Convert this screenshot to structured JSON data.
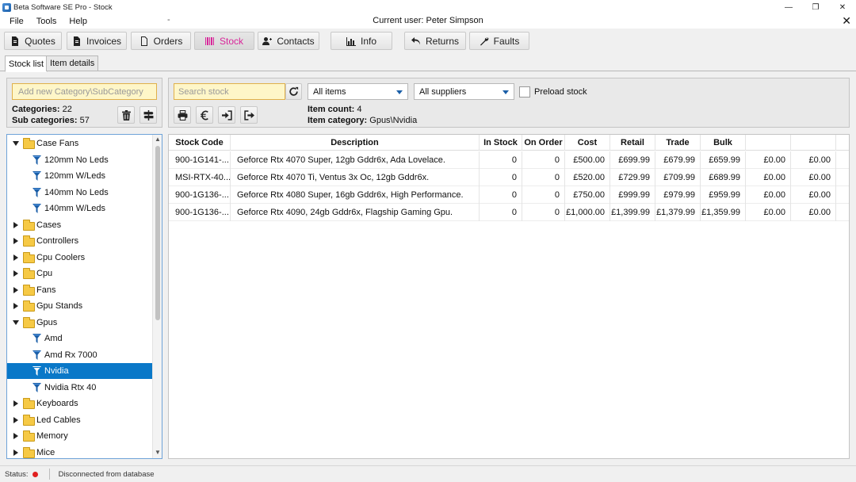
{
  "window": {
    "title": "Beta Software SE Pro - Stock",
    "controls": [
      "—",
      "❐",
      "✕"
    ]
  },
  "menu": {
    "items": [
      "File",
      "Tools",
      "Help"
    ],
    "dash": "-",
    "current_user": "Current user: Peter Simpson",
    "close": "✕"
  },
  "toolbar": {
    "buttons": [
      {
        "label": "Quotes",
        "icon": "document-icon"
      },
      {
        "label": "Invoices",
        "icon": "document-icon"
      },
      {
        "label": "Orders",
        "icon": "blank-document-icon"
      },
      {
        "label": "Stock",
        "icon": "barcode-icon",
        "active": true
      },
      {
        "label": "Contacts",
        "icon": "add-user-icon"
      },
      {
        "label": "Info",
        "icon": "bar-chart-icon"
      },
      {
        "label": "Returns",
        "icon": "undo-icon"
      },
      {
        "label": "Faults",
        "icon": "wrench-icon"
      }
    ],
    "active_color": "#d8279a"
  },
  "tabs": [
    "Stock list",
    "Item details"
  ],
  "category_panel": {
    "placeholder": "Add new Category\\SubCategory",
    "categories_label": "Categories:",
    "categories_count": "22",
    "subcategories_label": "Sub categories:",
    "subcategories_count": "57"
  },
  "stock_panel": {
    "search_placeholder": "Search stock",
    "items_filter": "All items",
    "suppliers_filter": "All suppliers",
    "preload_label": "Preload stock",
    "item_count_label": "Item count:",
    "item_count": "4",
    "item_category_label": "Item category:",
    "item_category": "Gpus\\Nvidia"
  },
  "tree": {
    "selected_color": "#0a78c8",
    "rows": [
      {
        "label": "Case Fans",
        "type": "folder",
        "expanded": true
      },
      {
        "label": "120mm No Leds",
        "type": "leaf"
      },
      {
        "label": "120mm W/Leds",
        "type": "leaf"
      },
      {
        "label": "140mm No Leds",
        "type": "leaf"
      },
      {
        "label": "140mm W/Leds",
        "type": "leaf"
      },
      {
        "label": "Cases",
        "type": "folder",
        "expanded": false
      },
      {
        "label": "Controllers",
        "type": "folder",
        "expanded": false
      },
      {
        "label": "Cpu Coolers",
        "type": "folder",
        "expanded": false
      },
      {
        "label": "Cpu",
        "type": "folder",
        "expanded": false
      },
      {
        "label": "Fans",
        "type": "folder",
        "expanded": false
      },
      {
        "label": "Gpu Stands",
        "type": "folder",
        "expanded": false
      },
      {
        "label": "Gpus",
        "type": "folder",
        "expanded": true
      },
      {
        "label": "Amd",
        "type": "leaf"
      },
      {
        "label": "Amd Rx 7000",
        "type": "leaf"
      },
      {
        "label": "Nvidia",
        "type": "leaf",
        "selected": true
      },
      {
        "label": "Nvidia Rtx 40",
        "type": "leaf"
      },
      {
        "label": "Keyboards",
        "type": "folder",
        "expanded": false
      },
      {
        "label": "Led Cables",
        "type": "folder",
        "expanded": false
      },
      {
        "label": "Memory",
        "type": "folder",
        "expanded": false
      },
      {
        "label": "Mice",
        "type": "folder",
        "expanded": false
      }
    ]
  },
  "grid": {
    "columns": [
      "Stock Code",
      "Description",
      "In Stock",
      "On Order",
      "Cost",
      "Retail",
      "Trade",
      "Bulk",
      "",
      ""
    ],
    "rows": [
      [
        "900-1G141-...",
        "Geforce Rtx 4070 Super, 12gb Gddr6x, Ada Lovelace.",
        "0",
        "0",
        "£500.00",
        "£699.99",
        "£679.99",
        "£659.99",
        "£0.00",
        "£0.00"
      ],
      [
        "MSI-RTX-40...",
        "Geforce Rtx 4070 Ti, Ventus 3x Oc, 12gb Gddr6x.",
        "0",
        "0",
        "£520.00",
        "£729.99",
        "£709.99",
        "£689.99",
        "£0.00",
        "£0.00"
      ],
      [
        "900-1G136-...",
        "Geforce Rtx 4080 Super, 16gb Gddr6x, High Performance.",
        "0",
        "0",
        "£750.00",
        "£999.99",
        "£979.99",
        "£959.99",
        "£0.00",
        "£0.00"
      ],
      [
        "900-1G136-...",
        "Geforce Rtx 4090, 24gb Gddr6x, Flagship Gaming Gpu.",
        "0",
        "0",
        "£1,000.00",
        "£1,399.99",
        "£1,379.99",
        "£1,359.99",
        "£0.00",
        "£0.00"
      ]
    ]
  },
  "status": {
    "label": "Status:",
    "dot_color": "#e02020",
    "message": "Disconnected from database"
  }
}
